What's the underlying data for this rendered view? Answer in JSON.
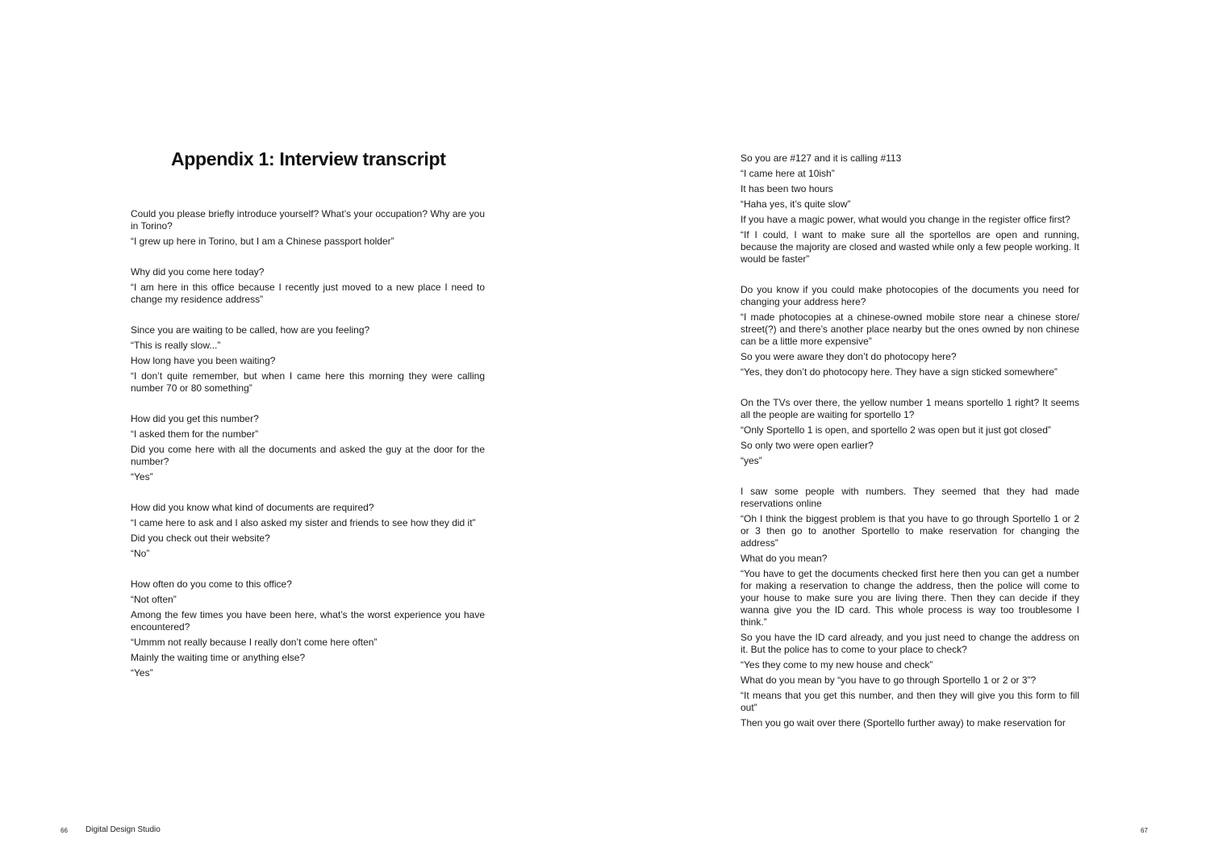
{
  "left_page": {
    "title": "Appendix 1: Interview transcript",
    "blocks": [
      [
        "Could you please briefly introduce yourself? What’s your occupation? Why are you in Torino?",
        "“I grew up here in Torino, but I am a Chinese passport holder”"
      ],
      [
        "Why did you come here today?",
        "“I am here in this office because I recently just moved to a new place I need to change my residence address”"
      ],
      [
        "Since you are waiting to be called, how are you feeling?",
        "“This is really slow...”",
        "How long have you been waiting?",
        "“I don’t quite remember, but when I came here this morning they were calling number 70 or 80 something”"
      ],
      [
        "How did you get this number?",
        "“I asked them for the number”",
        "Did you come here with all the documents and asked the guy at the door for the number?",
        "“Yes”"
      ],
      [
        "How did you know what kind of documents are required?",
        "“I came here to ask and I also asked my sister and friends to see how they did it”",
        "Did you check out their website?",
        "“No”"
      ],
      [
        "How often do you come to this office?",
        "“Not often”",
        "Among the few times you have been here, what’s the worst experience you have encountered?",
        "“Ummm not really because I really don’t come here often”",
        "Mainly the waiting time or anything else?",
        "“Yes”"
      ]
    ],
    "page_number": "66",
    "footer_title": "Digital Design Studio"
  },
  "right_page": {
    "blocks": [
      [
        "So you are #127 and it is calling #113",
        "“I came here at 10ish”",
        "It has been two hours",
        "“Haha yes, it’s quite slow”",
        "If you have a magic power, what would you change in the register office first?",
        "“If I could, I want to make sure all the sportellos are open and running, because the majority are closed and wasted while only a few people working. It would be faster”"
      ],
      [
        "Do you know if you could make photocopies of the documents you need for changing your address here?",
        "“I made photocopies at a chinese-owned mobile store near a chinese store/ street(?) and there’s another place nearby but the ones owned by non chinese can be a little more expensive”",
        "So you were aware they don’t do photocopy here?",
        "“Yes, they don’t do photocopy here. They have a sign sticked somewhere”"
      ],
      [
        "On the TVs over there, the yellow number 1 means sportello 1 right? It seems all the people are waiting for sportello 1?",
        "“Only Sportello 1 is open, and sportello 2 was open but it just got closed”",
        "So only two were open earlier?",
        "“yes”"
      ],
      [
        "I saw some people with numbers. They seemed that they had made reservations online",
        "“Oh I think the biggest problem is that you have to go through Sportello 1 or 2 or 3 then go to another Sportello to make reservation for changing the address”",
        "What do you mean?",
        "“You have to get the documents checked first here then you can get a number for making a reservation to change the address, then the police will come to your house to make sure you are living there. Then they can decide if they wanna give you the ID card. This whole process is way too troublesome I think.”",
        "So you have the ID card already, and you just need to change the address on it. But the police has to come to your place to check?",
        "“Yes they come to my new house and check”",
        "What do you mean by “you have to go through Sportello 1 or 2 or 3”?",
        "“It means that you get this number, and then they will give you this form to fill out”",
        "Then you go wait over there (Sportello further away) to make reservation for"
      ]
    ],
    "page_number": "67"
  }
}
